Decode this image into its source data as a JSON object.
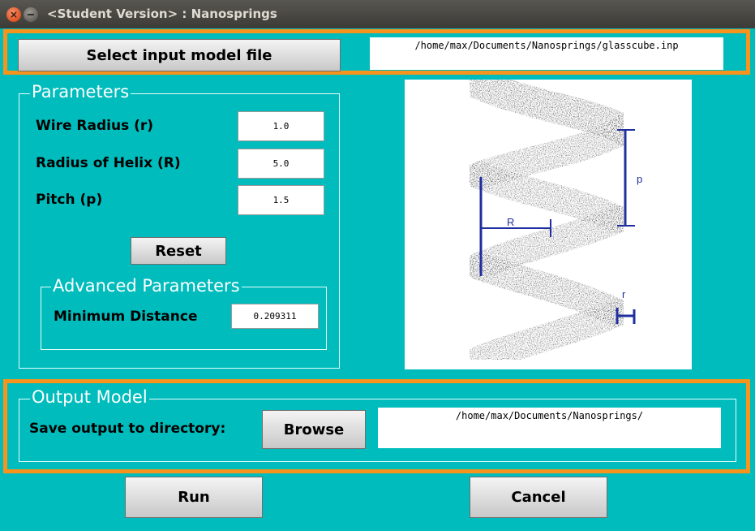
{
  "window": {
    "title": "<Student Version> : Nanosprings",
    "close_glyph": "×"
  },
  "input_file": {
    "button_label": "Select input model file",
    "path": "/home/max/Documents/Nanosprings/glasscube.inp"
  },
  "parameters": {
    "legend": "Parameters",
    "fields": [
      {
        "label": "Wire Radius (r)",
        "value": "1.0"
      },
      {
        "label": "Radius of Helix (R)",
        "value": "5.0"
      },
      {
        "label": "Pitch (p)",
        "value": "1.5"
      }
    ],
    "reset_label": "Reset",
    "advanced": {
      "legend": "Advanced Parameters",
      "label": "Minimum Distance",
      "value": "0.209311"
    }
  },
  "diagram": {
    "labels": {
      "R": "R",
      "p": "p",
      "r": "r"
    },
    "dimension_color": "#1f2f9f"
  },
  "output": {
    "legend": "Output Model",
    "label": "Save output to directory:",
    "browse_label": "Browse",
    "path": "/home/max/Documents/Nanosprings/"
  },
  "actions": {
    "run_label": "Run",
    "cancel_label": "Cancel"
  },
  "colors": {
    "background": "#00bcbc",
    "highlight": "#f7941d"
  }
}
